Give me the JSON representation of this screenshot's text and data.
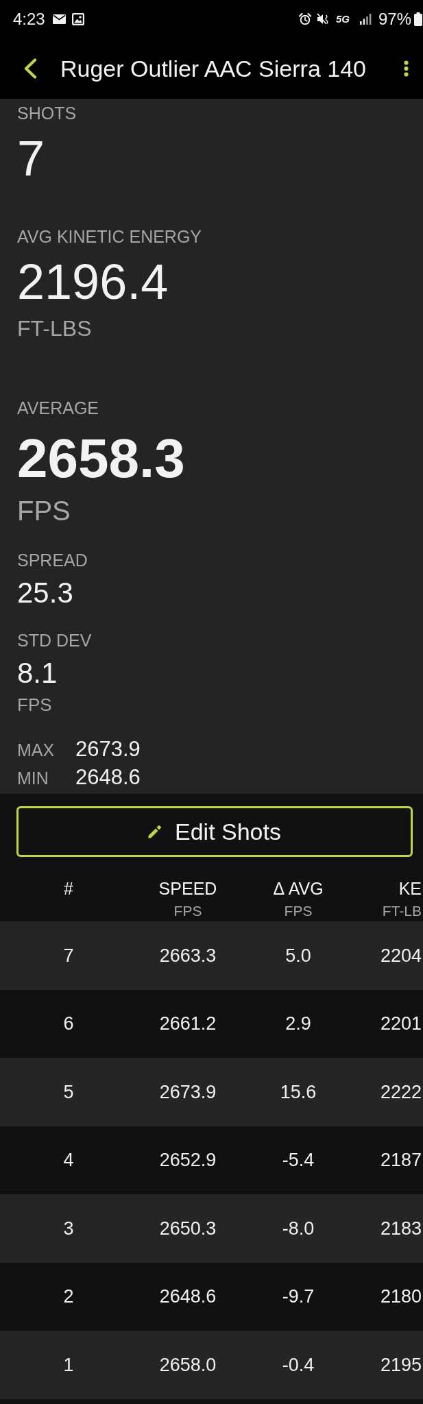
{
  "status_bar": {
    "time": "4:23",
    "network": "5G",
    "battery": "97%"
  },
  "app_bar": {
    "title": "Ruger Outlier AAC Sierra 140"
  },
  "summary": [
    {
      "kind": "large",
      "label": "SHOTS",
      "value": "7"
    },
    {
      "kind": "large",
      "label": "AVG KINETIC ENERGY",
      "value": "2196.4",
      "unit": "FT-LBS"
    },
    {
      "kind": "hero",
      "label": "AVERAGE",
      "value": "2658.3",
      "unit": "FPS"
    },
    {
      "kind": "medium",
      "label": "SPREAD",
      "value": "25.3"
    },
    {
      "kind": "medium",
      "label": "STD DEV",
      "value": "8.1",
      "unit": "FPS"
    },
    {
      "kind": "pair",
      "label": "MAX",
      "value": "2673.9"
    },
    {
      "kind": "pair",
      "label": "MIN",
      "value": "2648.6"
    }
  ],
  "edit_button": {
    "label": "Edit Shots"
  },
  "table": {
    "columns": [
      {
        "title": "#"
      },
      {
        "title": "SPEED",
        "unit": "FPS"
      },
      {
        "title": "Δ AVG",
        "unit": "FPS"
      },
      {
        "title": "KE",
        "unit": "FT-LB"
      }
    ],
    "rows": [
      [
        "7",
        "2663.3",
        "5.0",
        "2204"
      ],
      [
        "6",
        "2661.2",
        "2.9",
        "2201"
      ],
      [
        "5",
        "2673.9",
        "15.6",
        "2222"
      ],
      [
        "4",
        "2652.9",
        "-5.4",
        "2187"
      ],
      [
        "3",
        "2650.3",
        "-8.0",
        "2183"
      ],
      [
        "2",
        "2648.6",
        "-9.7",
        "2180"
      ],
      [
        "1",
        "2658.0",
        "-0.4",
        "2195"
      ]
    ]
  }
}
